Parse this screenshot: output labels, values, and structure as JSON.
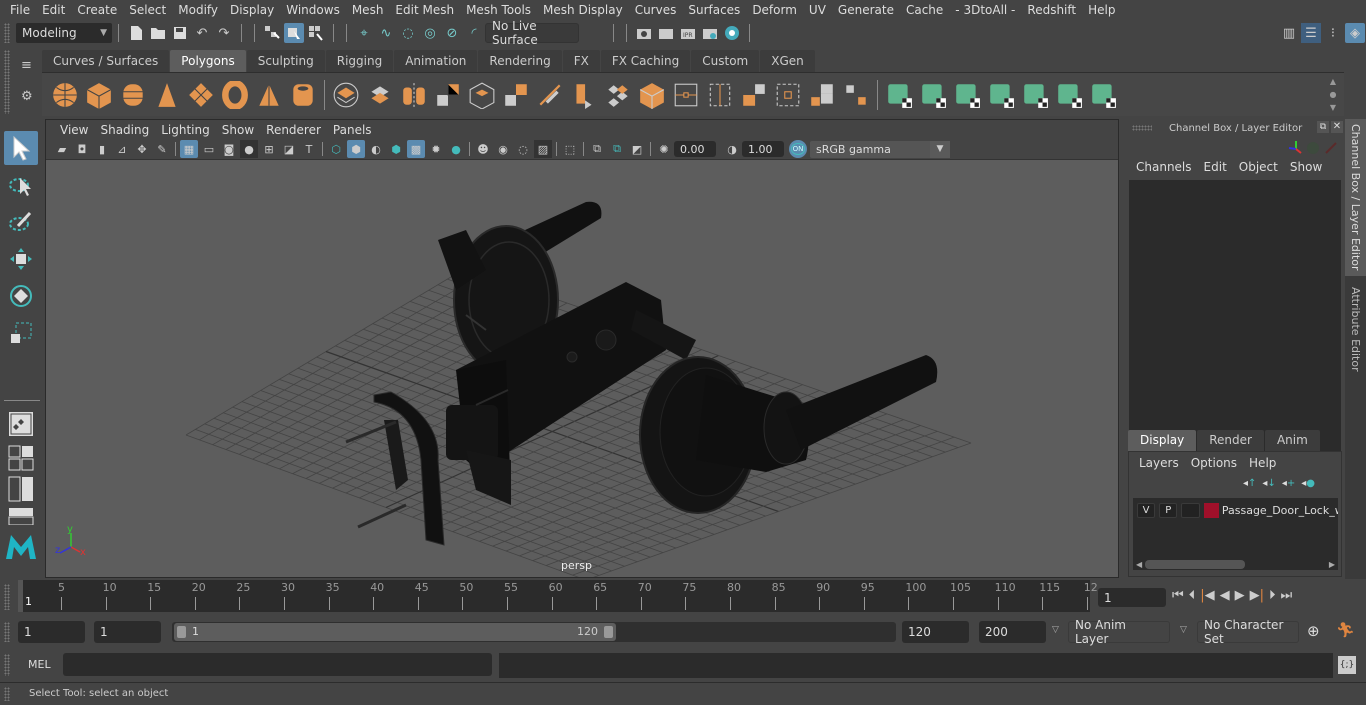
{
  "menubar": {
    "items": [
      "File",
      "Edit",
      "Create",
      "Select",
      "Modify",
      "Display",
      "Windows",
      "Mesh",
      "Edit Mesh",
      "Mesh Tools",
      "Mesh Display",
      "Curves",
      "Surfaces",
      "Deform",
      "UV",
      "Generate",
      "Cache",
      "- 3DtoAll -",
      "Redshift",
      "Help"
    ]
  },
  "statusline": {
    "mode": "Modeling",
    "live_surface": "No Live Surface",
    "icons": [
      "new-scene-icon",
      "open-scene-icon",
      "save-scene-icon",
      "undo-icon",
      "redo-icon",
      "select-hierarchy-icon",
      "select-object-icon",
      "select-component-icon",
      "snap-grid-icon",
      "snap-curve-icon",
      "snap-point-icon",
      "snap-view-plane-icon",
      "snap-surface-icon",
      "make-live-icon",
      "render-view-icon",
      "render-current-icon",
      "ipr-render-icon",
      "render-settings-icon",
      "hypershade-icon"
    ],
    "right_icons": [
      "modeling-toolkit-icon",
      "attribute-editor-icon",
      "tool-settings-icon",
      "channel-box-icon"
    ]
  },
  "shelf": {
    "tabs": [
      "Curves / Surfaces",
      "Polygons",
      "Sculpting",
      "Rigging",
      "Animation",
      "Rendering",
      "FX",
      "FX Caching",
      "Custom",
      "XGen"
    ],
    "active_tab": "Polygons",
    "icons_orange": [
      "poly-sphere-icon",
      "poly-cube-icon",
      "poly-cylinder-icon",
      "poly-cone-icon",
      "poly-plane-icon",
      "poly-torus-icon",
      "poly-pyramid-icon",
      "poly-pipe-icon"
    ],
    "icons_mid": [
      "combine-icon",
      "separate-icon",
      "mirror-icon",
      "smooth-icon",
      "reduce-icon",
      "subdivide-icon",
      "multi-cut-icon",
      "extrude-icon",
      "bridge-icon",
      "bevel-icon",
      "insert-edge-loop-icon",
      "offset-edge-loop-icon",
      "append-polygon-icon",
      "fill-hole-icon",
      "merge-icon",
      "target-weld-icon"
    ],
    "icons_green": [
      "planar-map-icon",
      "cylindrical-map-icon",
      "spherical-map-icon",
      "automatic-map-icon",
      "unfold-icon",
      "uv-editor-icon",
      "layout-uv-icon"
    ]
  },
  "viewport": {
    "menu": [
      "View",
      "Shading",
      "Lighting",
      "Show",
      "Renderer",
      "Panels"
    ],
    "exposure": "0.00",
    "gamma": "1.00",
    "color_management": "ON",
    "color_space": "sRGB gamma",
    "camera_label": "persp",
    "axis": {
      "x": "x",
      "y": "y",
      "z": "z"
    }
  },
  "channel_box": {
    "title": "Channel Box / Layer Editor",
    "menu": [
      "Channels",
      "Edit",
      "Object",
      "Show"
    ]
  },
  "layer_editor": {
    "tabs": [
      "Display",
      "Render",
      "Anim"
    ],
    "active_tab": "Display",
    "menu": [
      "Layers",
      "Options",
      "Help"
    ],
    "layers": [
      {
        "visible": "V",
        "playback": "P",
        "color": "#a0102a",
        "name": "Passage_Door_Lock_w"
      }
    ]
  },
  "side_tabs": [
    "Channel Box / Layer Editor",
    "Attribute Editor"
  ],
  "timeline": {
    "ticks": [
      "5",
      "10",
      "15",
      "20",
      "25",
      "30",
      "35",
      "40",
      "45",
      "50",
      "55",
      "60",
      "65",
      "70",
      "75",
      "80",
      "85",
      "90",
      "95",
      "100",
      "105",
      "110",
      "115",
      "12"
    ],
    "current_marker": "1",
    "current_frame": "1"
  },
  "range": {
    "start": "1",
    "anim_start": "1",
    "slider_start": "1",
    "slider_end": "120",
    "anim_end": "120",
    "end": "200",
    "anim_layer": "No Anim Layer",
    "character_set": "No Character Set"
  },
  "command_line": {
    "label": "MEL",
    "value": ""
  },
  "help_line": "Select Tool: select an object",
  "colors": {
    "accent": "#5b8bb0",
    "shelf_orange": "#e3954f",
    "shelf_green": "#5fb58e",
    "key_orange": "#e08540"
  }
}
